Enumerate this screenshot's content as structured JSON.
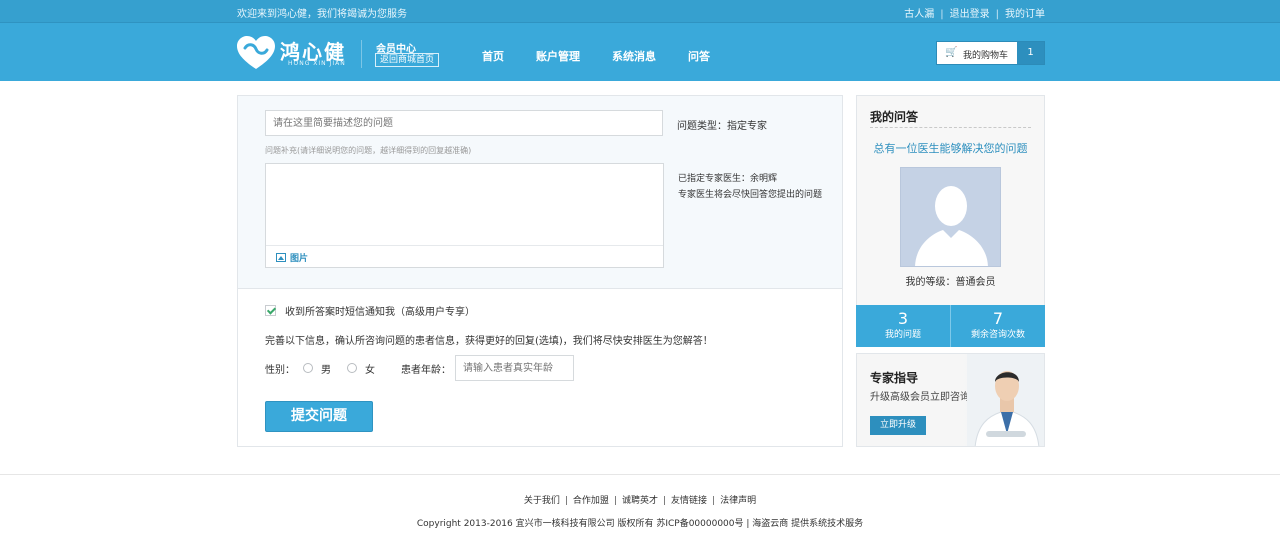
{
  "header": {
    "welcome": "欢迎来到鸿心健，我们将竭诚为您服务",
    "user_links": [
      "古人漏",
      "退出登录",
      "我的订单"
    ],
    "logo": {
      "text": "鸿心健",
      "sub": "HONG XIN JIAN"
    },
    "member_center": "会员中心",
    "back_to_shop": "返回商城首页",
    "nav": [
      "首页",
      "账户管理",
      "系统消息",
      "问答"
    ],
    "cart": {
      "label": "我的购物车",
      "count": "1"
    }
  },
  "question": {
    "title_placeholder": "请在这里简要描述您的问题",
    "type_label": "问题类型：指定专家",
    "supplement_hint": "问题补充(请详细说明您的问题，越详细得到的回复越准确)",
    "image_button": "图片",
    "assigned_doctor": "已指定专家医生：余明辉",
    "doctor_note": "专家医生将会尽快回答您提出的问题",
    "sms_notice": "收到所答案时短信通知我（高级用户专享）",
    "info_prompt": "完善以下信息，确认所咨询问题的患者信息，获得更好的回复(选填)，我们将尽快安排医生为您解答！",
    "gender_label": "性别：",
    "gender_options": [
      "男",
      "女"
    ],
    "age_label": "患者年龄：",
    "age_placeholder": "请输入患者真实年龄",
    "submit": "提交问题"
  },
  "sidebar": {
    "title": "我的问答",
    "slogan": "总有一位医生能够解决您的问题",
    "level": "我的等级：普通会员",
    "stats": [
      {
        "value": "3",
        "label": "我的问题"
      },
      {
        "value": "7",
        "label": "剩余咨询次数"
      }
    ],
    "expert": {
      "title": "专家指导",
      "subtitle": "升级高级会员立即咨询",
      "button": "立即升级"
    }
  },
  "footer": {
    "links": [
      "关于我们",
      "合作加盟",
      "诚聘英才",
      "友情链接",
      "法律声明"
    ],
    "copyright": "Copyright 2013-2016 宜兴市一核科技有限公司 版权所有 苏ICP备00000000号 | 海盗云商 提供系统技术服务"
  },
  "colors": {
    "brand": "#3aa9da",
    "accent": "#2d8fbe",
    "check": "#3aa86a"
  }
}
